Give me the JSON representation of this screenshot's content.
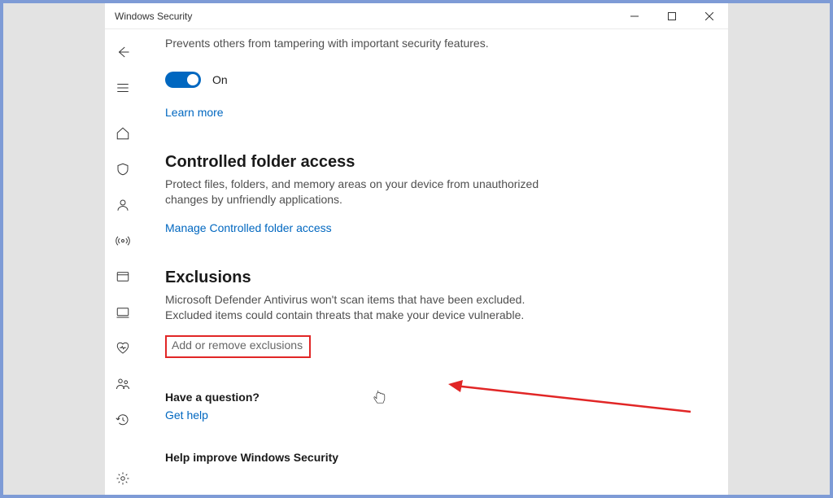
{
  "window": {
    "title": "Windows Security"
  },
  "tamper": {
    "description": "Prevents others from tampering with important security features.",
    "toggle_state": "On",
    "learn_more": "Learn more"
  },
  "cfa": {
    "heading": "Controlled folder access",
    "description": "Protect files, folders, and memory areas on your device from unauthorized changes by unfriendly applications.",
    "link": "Manage Controlled folder access"
  },
  "exclusions": {
    "heading": "Exclusions",
    "description": "Microsoft Defender Antivirus won't scan items that have been excluded. Excluded items could contain threats that make your device vulnerable.",
    "link": "Add or remove exclusions"
  },
  "question": {
    "heading": "Have a question?",
    "link": "Get help"
  },
  "improve": {
    "heading": "Help improve Windows Security"
  }
}
